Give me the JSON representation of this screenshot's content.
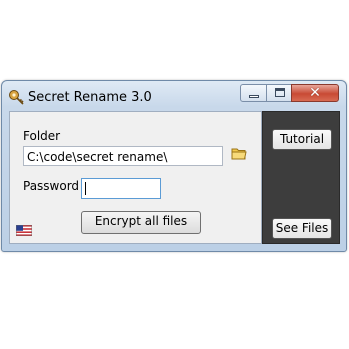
{
  "window": {
    "title": "Secret Rename 3.0"
  },
  "titlebar": {
    "minimize_icon": "minimize-icon",
    "maximize_icon": "maximize-icon",
    "close_glyph": "✕"
  },
  "form": {
    "folder_label": "Folder",
    "folder_value": "C:\\code\\secret rename\\",
    "password_label": "Password",
    "password_value": "",
    "encrypt_button": "Encrypt all files"
  },
  "side": {
    "tutorial_button": "Tutorial",
    "see_files_button": "See Files"
  },
  "icons": {
    "app": "key-icon",
    "browse": "folder-icon",
    "language": "us-flag-icon"
  },
  "colors": {
    "titlebar": "#c8d8ea",
    "close": "#c84a34",
    "side_panel": "#3d3d3d",
    "client": "#f0f0f0"
  }
}
